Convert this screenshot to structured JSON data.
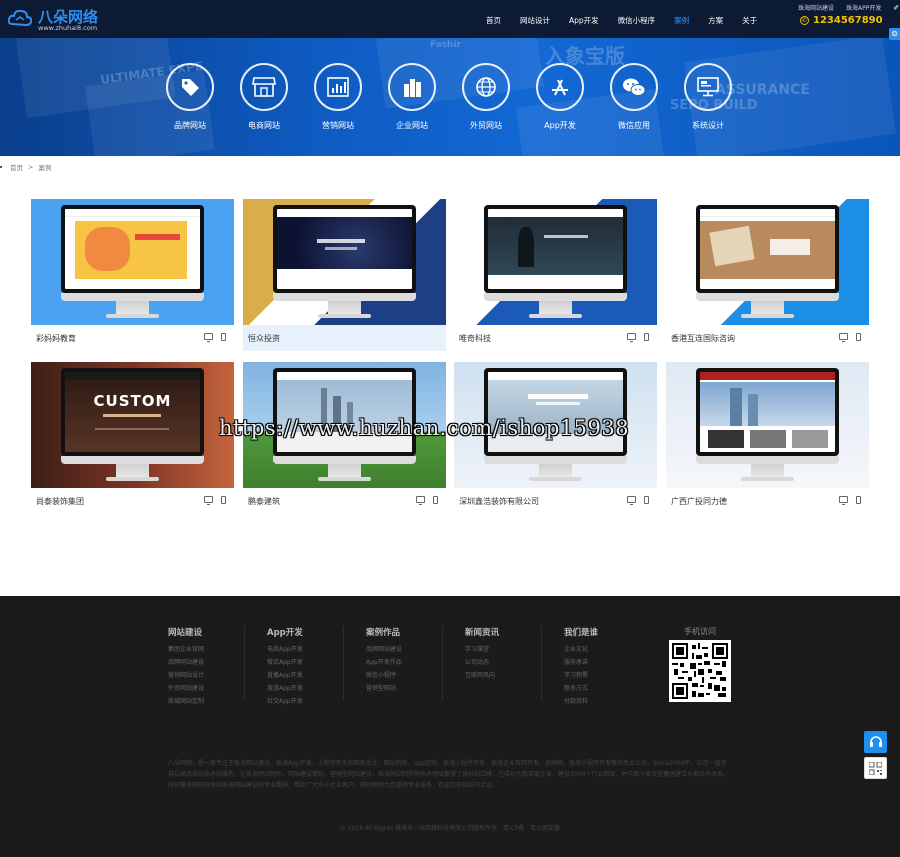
{
  "brand": {
    "name": "八朵网络",
    "url": "www.zhuhai8.com",
    "accent": "#2f8ff0"
  },
  "nav": [
    {
      "label": "首页",
      "active": false
    },
    {
      "label": "网站设计",
      "active": false
    },
    {
      "label": "App开发",
      "active": false
    },
    {
      "label": "微信小程序",
      "active": false
    },
    {
      "label": "案例",
      "active": true
    },
    {
      "label": "方案",
      "active": false
    },
    {
      "label": "关于",
      "active": false
    }
  ],
  "top_links": {
    "web": "珠海网站建设",
    "app": "珠海APP开发"
  },
  "phone": "1234567890",
  "categories": [
    {
      "label": "品牌网站",
      "icon": "tag-icon"
    },
    {
      "label": "电商网站",
      "icon": "shop-icon"
    },
    {
      "label": "营销网站",
      "icon": "chart-icon"
    },
    {
      "label": "企业网站",
      "icon": "building-icon"
    },
    {
      "label": "外贸网站",
      "icon": "globe-icon"
    },
    {
      "label": "App开发",
      "icon": "appstore-icon"
    },
    {
      "label": "微信应用",
      "icon": "wechat-icon"
    },
    {
      "label": "系统设计",
      "icon": "monitor-icon"
    }
  ],
  "breadcrumb": {
    "home": "首页",
    "sep": ">",
    "current": "案例"
  },
  "cases": [
    {
      "title": "彩妈妈教育",
      "highlighted": false
    },
    {
      "title": "恒众投资",
      "highlighted": true
    },
    {
      "title": "唯奇科技",
      "highlighted": false
    },
    {
      "title": "香港互连国际咨询",
      "highlighted": false
    },
    {
      "title": "尚泰装饰集团",
      "highlighted": false,
      "screen_text": "CUSTOM"
    },
    {
      "title": "鹏泰建筑",
      "highlighted": false
    },
    {
      "title": "深圳鑫浩装饰有限公司",
      "highlighted": false
    },
    {
      "title": "广西广投同力德",
      "highlighted": false
    }
  ],
  "watermark": "https://www.huzhan.com/ishop15938",
  "footer": {
    "columns": [
      {
        "title": "网站建设",
        "links": [
          "集团企业官网",
          "品牌网站建设",
          "营销网站设计",
          "外贸网站建设",
          "商城网站定制"
        ]
      },
      {
        "title": "App开发",
        "links": [
          "电商App开发",
          "餐饮App开发",
          "直播App开发",
          "旅游App开发",
          "社交App开发"
        ]
      },
      {
        "title": "案例作品",
        "links": [
          "品牌网站建设",
          "App开发作品",
          "微信小程序",
          "营销型网站"
        ]
      },
      {
        "title": "新闻资讯",
        "links": [
          "学习课堂",
          "公司动态",
          "互联网风向"
        ]
      },
      {
        "title": "我们是谁",
        "links": [
          "企业文化",
          "服务承诺",
          "学习积累",
          "联系方式",
          "付款资料"
        ]
      }
    ],
    "qr_title": "手机访问",
    "description": "八朵网络，是一家专注于珠海网站建设、珠海App开发、小程序开发和网页设计、网站制作、app定制、珠海小程序开发、珠海企业官网开发、品牌网、珠海小程序开发等的专业公司。Since2008年，公司一直坚持以高品质的技术和服务，在珠海网站制作、网站建设策划、营销型网站建设、珠海网站制作等技术领域赢得了良好的口碑，已成功为数百家企业、建设3000个行业网站，并与数十家大型集团建立长期合作关系。时刻秉承网站开发和珠海网站建设的专业精神，帮助广大中小企业客户，随时随地为您提供专业服务，欢迎您莅临访问洽谈。",
    "copyright": "© 2018 All Rights 珠海市八朵网络科技有限公司版权所有",
    "icp": "粤ICP备",
    "record": "粤公网安备"
  }
}
